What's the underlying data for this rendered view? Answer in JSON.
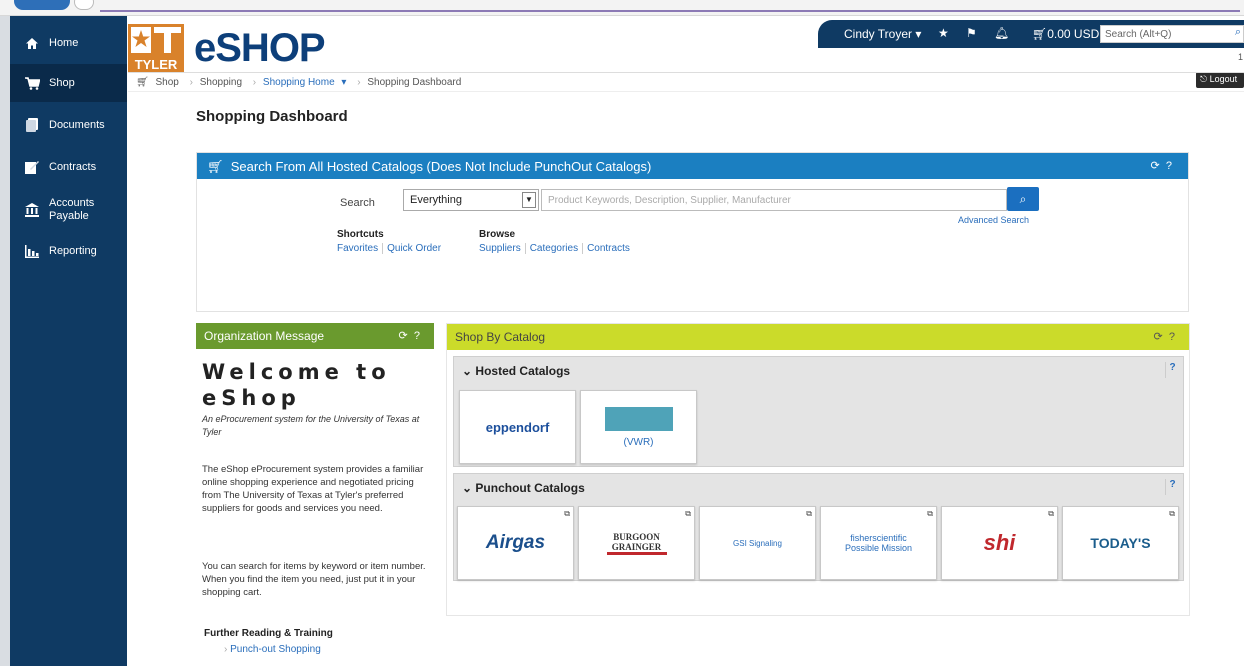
{
  "sidebar": {
    "items": [
      {
        "label": "Home",
        "icon": "home-icon"
      },
      {
        "label": "Shop",
        "icon": "cart-icon"
      },
      {
        "label": "Documents",
        "icon": "documents-icon"
      },
      {
        "label": "Contracts",
        "icon": "contracts-icon"
      },
      {
        "label": "Accounts Payable",
        "icon": "bank-icon"
      },
      {
        "label": "Reporting",
        "icon": "bar-chart-icon"
      }
    ]
  },
  "header": {
    "logo_text": "TYLER",
    "brand": "eSHOP",
    "user_name": "Cindy Troyer",
    "cart_total": "0.00 USD",
    "search_placeholder": "Search (Alt+Q)",
    "logout_label": "Logout",
    "extra_number": "1"
  },
  "breadcrumb": {
    "items": [
      "Shop",
      "Shopping",
      "Shopping Home",
      "Shopping Dashboard"
    ]
  },
  "page_title": "Shopping Dashboard",
  "search_panel": {
    "title": "Search From All Hosted Catalogs (Does Not Include PunchOut Catalogs)",
    "search_label": "Search",
    "select_value": "Everything",
    "input_placeholder": "Product Keywords, Description, Supplier, Manufacturer",
    "advanced_search": "Advanced Search",
    "shortcuts_title": "Shortcuts",
    "shortcuts": [
      "Favorites",
      "Quick Order"
    ],
    "browse_title": "Browse",
    "browse": [
      "Suppliers",
      "Categories",
      "Contracts"
    ]
  },
  "org_panel": {
    "title": "Organization Message",
    "welcome": "Welcome to eShop",
    "subtitle": "An eProcurement system for the University of Texas at Tyler",
    "body1": "The eShop eProcurement system provides a familiar online shopping experience and negotiated pricing from The University of Texas at Tyler's preferred suppliers for goods and services you need.",
    "body2": "You can search for items by keyword or item number. When you find the item you need, just put it in your shopping cart.",
    "further_title": "Further Reading & Training",
    "further_link": "Punch-out Shopping"
  },
  "catalog_panel": {
    "title": "Shop By Catalog",
    "hosted_title": "Hosted Catalogs",
    "hosted": [
      {
        "name": "eppendorf"
      },
      {
        "name": "(VWR)"
      }
    ],
    "punchout_title": "Punchout Catalogs",
    "punchout": [
      {
        "name": "Airgas"
      },
      {
        "name": "BURGOON GRAINGER"
      },
      {
        "name": "GSI Signaling"
      },
      {
        "name": "fisherscientific Possible Mission"
      },
      {
        "name": "shi"
      },
      {
        "name": "TODAY'S"
      }
    ]
  },
  "colors": {
    "sidebar": "#0f3a63",
    "search_header": "#1b7fc1",
    "org_header": "#6a9a2e",
    "catalog_header": "#cbdb2a",
    "tyler_orange": "#d9822b"
  }
}
